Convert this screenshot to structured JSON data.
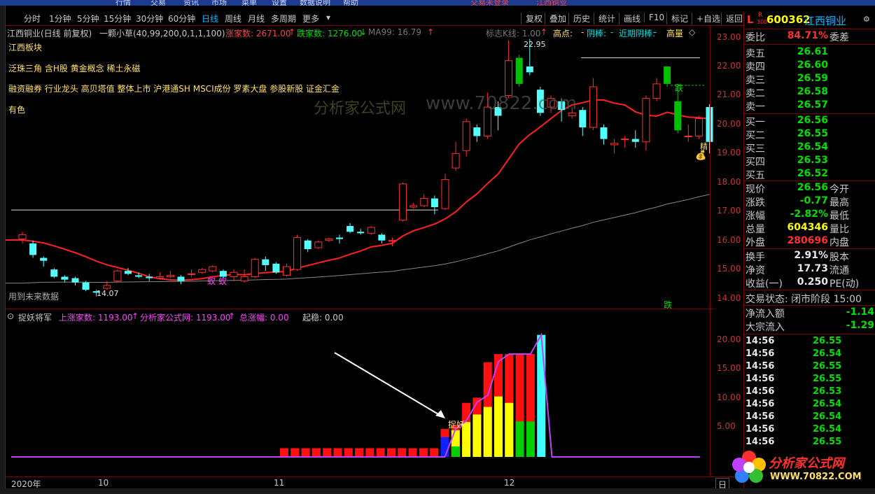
{
  "top_menu": [
    "行情",
    "交易",
    "资讯",
    "市场",
    "菜单",
    "设置",
    "数据说明",
    "帮助"
  ],
  "top_status": "交易未登录",
  "top_stock": "江西铜业",
  "toolbar": {
    "periods": [
      "分时",
      "1分钟",
      "5分钟",
      "15分钟",
      "30分钟",
      "60分钟",
      "日线",
      "周线",
      "月线",
      "多周期",
      "更多"
    ],
    "active": "日线",
    "right_buttons": [
      "复权",
      "叠加",
      "历史",
      "统计",
      "画线",
      "F10",
      "标记",
      "+自选",
      "返回"
    ]
  },
  "main_legend": {
    "name": "江西铜业(日线 前复权)",
    "indicator": "一颗小草(40,99,200,0,1,1,100)",
    "up_label": "涨家数: 2671.00",
    "down_label": "跌家数: 1276.00",
    "ma_label": "MA99: 16.79",
    "kline_label": "标志K线: 1.00",
    "high_label": "高点:",
    "yin_label": "阴棒:",
    "recent_yin_label": "近期阴棒:",
    "vol_label": "高量"
  },
  "tags": [
    "江西板块",
    "泛珠三角 含H股 黄金概念 稀土永磁",
    "融资融券 行业龙头 高贝塔值 整体上市 沪港通SH MSCI成份 罗素大盘 参股新股 证金汇金",
    "有色"
  ],
  "future_note": "用到未来数据",
  "annotations": {
    "high": "22.95",
    "low": "14.07",
    "ant": "蚁",
    "die": "跌",
    "die2": "跌",
    "jing": "精",
    "watermark_url": "www.70822.com",
    "watermark_cn": "分析家公式网"
  },
  "price_axis": [
    "23.00",
    "22.00",
    "21.00",
    "20.00",
    "19.00",
    "18.00",
    "17.00",
    "16.00",
    "15.00",
    "14.00"
  ],
  "sub_axis": [
    "20.00",
    "15.00",
    "10.00",
    "5.00"
  ],
  "sub_legend": {
    "name": "捉妖将军",
    "up_label": "上涨家数: 1193.00",
    "site_label": "分析家公式网: 1193.00",
    "amp_label": "总涨幅: 0.00",
    "start_label": "起稳: 0.00"
  },
  "catch_label": "捉妖",
  "bottom_axis": [
    "2020年",
    "10",
    "11",
    "12"
  ],
  "bottom_right": "日",
  "quote": {
    "code": "600362",
    "name": "江西铜业",
    "board_top": "R",
    "board_bot": "300",
    "prefix": "L",
    "webi_label": "委比",
    "webi_value": "84.71%",
    "wecha_label": "委差",
    "asks": [
      {
        "label": "卖五",
        "price": "26.61"
      },
      {
        "label": "卖四",
        "price": "26.60"
      },
      {
        "label": "卖三",
        "price": "26.59"
      },
      {
        "label": "卖二",
        "price": "26.58"
      },
      {
        "label": "卖一",
        "price": "26.57"
      }
    ],
    "bids": [
      {
        "label": "买一",
        "price": "26.56"
      },
      {
        "label": "买二",
        "price": "26.55"
      },
      {
        "label": "买三",
        "price": "26.54"
      },
      {
        "label": "买四",
        "price": "26.53"
      },
      {
        "label": "买五",
        "price": "26.52"
      }
    ],
    "stats": [
      {
        "l1": "现价",
        "v1": "26.56",
        "c1": "green",
        "l2": "今开"
      },
      {
        "l1": "涨跌",
        "v1": "-0.77",
        "c1": "green",
        "l2": "最高"
      },
      {
        "l1": "涨幅",
        "v1": "-2.82%",
        "c1": "green",
        "l2": "最低"
      },
      {
        "l1": "总量",
        "v1": "604346",
        "c1": "yellow",
        "l2": "量比"
      },
      {
        "l1": "外盘",
        "v1": "280696",
        "c1": "red",
        "l2": "内盘"
      }
    ],
    "stats2": [
      {
        "l1": "换手",
        "v1": "2.91%",
        "c1": "white",
        "l2": "股本"
      },
      {
        "l1": "净资",
        "v1": "17.73",
        "c1": "white",
        "l2": "流通"
      },
      {
        "l1": "收益(一)",
        "v1": "0.250",
        "c1": "white",
        "l2": "PE(动)"
      }
    ],
    "trade_state": "交易状态: 闭市阶段 15:00",
    "net_inflow_label": "净流入额",
    "net_inflow_value": "-1.14",
    "block_inflow_label": "大宗流入",
    "block_inflow_value": "-1.29",
    "ticks": [
      {
        "t": "14:56",
        "p": "26.55"
      },
      {
        "t": "14:56",
        "p": "26.54"
      },
      {
        "t": "14:56",
        "p": "26.55"
      },
      {
        "t": "14:56",
        "p": "26.55"
      },
      {
        "t": "14:56",
        "p": "26.53"
      },
      {
        "t": "14:56",
        "p": "26.54"
      },
      {
        "t": "14:56",
        "p": "26.54"
      },
      {
        "t": "14:56",
        "p": "26.54"
      },
      {
        "t": "14:56",
        "p": "26.55"
      }
    ]
  },
  "logo": {
    "cn": "分析家公式网",
    "url": "WWW.70822.COM"
  },
  "chart_data": {
    "type": "candlestick",
    "ylim": [
      13.7,
      23.4
    ],
    "candles": [
      {
        "o": 16.05,
        "c": 16.2,
        "h": 16.3,
        "l": 15.9
      },
      {
        "o": 15.9,
        "c": 15.5,
        "h": 16.0,
        "l": 15.4
      },
      {
        "o": 15.4,
        "c": 15.3,
        "h": 15.45,
        "l": 15.1
      },
      {
        "o": 15.0,
        "c": 14.75,
        "h": 15.05,
        "l": 14.7
      },
      {
        "o": 14.75,
        "c": 14.65,
        "h": 14.8,
        "l": 14.55
      },
      {
        "o": 14.7,
        "c": 14.55,
        "h": 14.75,
        "l": 14.45
      },
      {
        "o": 14.55,
        "c": 14.3,
        "h": 14.6,
        "l": 14.25
      },
      {
        "o": 14.25,
        "c": 14.2,
        "h": 14.3,
        "l": 14.07
      },
      {
        "o": 14.35,
        "c": 14.45,
        "h": 14.6,
        "l": 14.3
      },
      {
        "o": 14.6,
        "c": 14.95,
        "h": 15.0,
        "l": 14.55
      },
      {
        "o": 14.95,
        "c": 14.85,
        "h": 15.05,
        "l": 14.8
      },
      {
        "o": 14.8,
        "c": 14.75,
        "h": 14.9,
        "l": 14.7
      },
      {
        "o": 14.75,
        "c": 14.7,
        "h": 14.85,
        "l": 14.6
      },
      {
        "o": 14.7,
        "c": 14.75,
        "h": 14.9,
        "l": 14.65
      },
      {
        "o": 14.75,
        "c": 14.8,
        "h": 14.95,
        "l": 14.7
      },
      {
        "o": 14.75,
        "c": 14.6,
        "h": 14.8,
        "l": 14.5
      },
      {
        "o": 14.85,
        "c": 14.85,
        "h": 15.0,
        "l": 14.75
      },
      {
        "o": 14.9,
        "c": 15.0,
        "h": 15.05,
        "l": 14.85
      },
      {
        "o": 14.95,
        "c": 15.1,
        "h": 15.15,
        "l": 14.9
      },
      {
        "o": 14.95,
        "c": 14.75,
        "h": 15.0,
        "l": 14.7
      },
      {
        "o": 14.75,
        "c": 14.9,
        "h": 15.0,
        "l": 14.6
      },
      {
        "o": 14.6,
        "c": 14.75,
        "h": 15.0,
        "l": 14.55
      },
      {
        "o": 14.75,
        "c": 15.35,
        "h": 15.4,
        "l": 14.7
      },
      {
        "o": 15.35,
        "c": 15.15,
        "h": 15.45,
        "l": 14.95
      },
      {
        "o": 15.2,
        "c": 14.9,
        "h": 15.25,
        "l": 14.85
      },
      {
        "o": 14.8,
        "c": 15.1,
        "h": 15.2,
        "l": 14.75
      },
      {
        "o": 15.0,
        "c": 16.1,
        "h": 16.2,
        "l": 14.95
      },
      {
        "o": 16.0,
        "c": 15.7,
        "h": 16.05,
        "l": 15.6
      },
      {
        "o": 15.75,
        "c": 15.95,
        "h": 16.0,
        "l": 15.7
      },
      {
        "o": 16.0,
        "c": 16.05,
        "h": 16.1,
        "l": 15.95
      },
      {
        "o": 16.1,
        "c": 16.05,
        "h": 16.2,
        "l": 15.9
      },
      {
        "o": 16.5,
        "c": 16.3,
        "h": 16.6,
        "l": 16.25
      },
      {
        "o": 16.3,
        "c": 16.25,
        "h": 16.4,
        "l": 16.2
      },
      {
        "o": 16.25,
        "c": 16.45,
        "h": 16.5,
        "l": 16.2
      },
      {
        "o": 16.2,
        "c": 16.0,
        "h": 16.25,
        "l": 15.9
      },
      {
        "o": 16.0,
        "c": 16.0,
        "h": 16.1,
        "l": 15.8
      },
      {
        "o": 16.7,
        "c": 17.95,
        "h": 18.0,
        "l": 16.65
      },
      {
        "o": 17.15,
        "c": 17.2,
        "h": 17.3,
        "l": 17.1
      },
      {
        "o": 17.2,
        "c": 17.45,
        "h": 17.6,
        "l": 17.15
      },
      {
        "o": 17.45,
        "c": 17.15,
        "h": 17.55,
        "l": 16.9
      },
      {
        "o": 17.1,
        "c": 18.1,
        "h": 18.3,
        "l": 17.05
      },
      {
        "o": 18.5,
        "c": 19.0,
        "h": 19.4,
        "l": 18.4
      },
      {
        "o": 19.1,
        "c": 20.1,
        "h": 20.2,
        "l": 18.9
      },
      {
        "o": 19.9,
        "c": 19.6,
        "h": 20.0,
        "l": 19.4
      },
      {
        "o": 19.6,
        "c": 20.6,
        "h": 21.1,
        "l": 19.5
      },
      {
        "o": 20.6,
        "c": 20.3,
        "h": 20.8,
        "l": 19.8
      },
      {
        "o": 21.0,
        "c": 22.2,
        "h": 22.9,
        "l": 20.9
      },
      {
        "o": 21.4,
        "c": 22.3,
        "h": 22.4,
        "l": 21.3
      },
      {
        "o": 22.0,
        "c": 21.8,
        "h": 22.95,
        "l": 21.7
      },
      {
        "o": 21.2,
        "c": 20.4,
        "h": 21.3,
        "l": 20.3
      },
      {
        "o": 20.6,
        "c": 20.9,
        "h": 21.0,
        "l": 20.4
      },
      {
        "o": 20.8,
        "c": 20.5,
        "h": 20.9,
        "l": 20.1
      },
      {
        "o": 20.3,
        "c": 20.4,
        "h": 20.6,
        "l": 20.2
      },
      {
        "o": 20.5,
        "c": 19.9,
        "h": 20.6,
        "l": 19.6
      },
      {
        "o": 19.9,
        "c": 21.3,
        "h": 21.6,
        "l": 19.8
      },
      {
        "o": 19.9,
        "c": 19.5,
        "h": 20.0,
        "l": 19.3
      },
      {
        "o": 19.3,
        "c": 19.35,
        "h": 19.5,
        "l": 19.0
      },
      {
        "o": 19.5,
        "c": 19.5,
        "h": 19.6,
        "l": 19.2
      },
      {
        "o": 19.5,
        "c": 19.4,
        "h": 19.8,
        "l": 19.2
      },
      {
        "o": 19.4,
        "c": 20.9,
        "h": 21.0,
        "l": 19.1
      },
      {
        "o": 20.9,
        "c": 21.4,
        "h": 21.6,
        "l": 20.8
      },
      {
        "o": 21.4,
        "c": 22.0,
        "h": 22.0,
        "l": 21.3
      },
      {
        "o": 20.8,
        "c": 19.8,
        "h": 21.4,
        "l": 19.7
      },
      {
        "o": 19.6,
        "c": 19.6,
        "h": 20.0,
        "l": 19.4
      },
      {
        "o": 19.6,
        "c": 20.2,
        "h": 20.3,
        "l": 19.5
      },
      {
        "o": 20.6,
        "c": 19.4,
        "h": 20.7,
        "l": 19.0
      }
    ],
    "green_marks": [
      47,
      61,
      62
    ],
    "indicator_bars": {
      "ylim": [
        0,
        23
      ],
      "bars": [
        {
          "red": 1.5,
          "yellow": 0,
          "green": 0,
          "blue": 0
        },
        {
          "red": 1.5
        },
        {
          "red": 1.5
        },
        {
          "red": 1.5
        },
        {
          "red": 1.5
        },
        {
          "red": 1.5
        },
        {
          "red": 1.5
        },
        {
          "red": 1.5
        },
        {
          "red": 1.5
        },
        {
          "red": 1.5
        },
        {
          "red": 1.5
        },
        {
          "red": 1.5
        },
        {
          "red": 1.5
        },
        {
          "red": 1.5
        },
        {
          "red": 1.5
        },
        {
          "base": 0,
          "blue": 3.4,
          "red": 4.8
        },
        {
          "green": 1.8,
          "yellow": 4.6,
          "red": 5.5
        },
        {
          "yellow": 6.0,
          "red": 9.3
        },
        {
          "yellow": 7.3,
          "red": 10.2
        },
        {
          "yellow": 8.6,
          "red": 16.3
        },
        {
          "yellow": 10.4,
          "red": 17.7
        },
        {
          "yellow": 9.3,
          "red": 17.7
        },
        {
          "green": 6.1,
          "red": 17.7
        },
        {
          "green": 6.1,
          "red": 17.7
        },
        {
          "cyan": 21.0
        }
      ],
      "line_points": [
        [
          0,
          0
        ],
        [
          15,
          0
        ],
        [
          16,
          4.8
        ],
        [
          17,
          6.2
        ],
        [
          18,
          9.4
        ],
        [
          19,
          10.6
        ],
        [
          20,
          16.4
        ],
        [
          21,
          17.7
        ],
        [
          22,
          17.7
        ],
        [
          23,
          17.7
        ],
        [
          24,
          21.0
        ],
        [
          25,
          0
        ],
        [
          31,
          0
        ]
      ]
    }
  }
}
